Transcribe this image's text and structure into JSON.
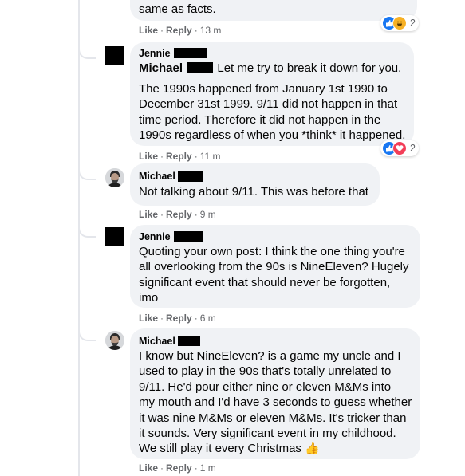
{
  "comments": [
    {
      "author": "",
      "text_lines": [
        "same as facts."
      ],
      "actions": {
        "like": "Like",
        "reply": "Reply",
        "time": "13 m"
      },
      "reactions": {
        "icons": [
          "like-icon",
          "haha-icon"
        ],
        "count": "2"
      }
    },
    {
      "author": "Jennie",
      "mention": "Michael",
      "text_first_line": "Let me try to break it down for you.",
      "text_lines": [
        "The 1990s happened from January 1st 1990 to",
        "December 31st 1999. 9/11 did not happen in that",
        "time period. Therefore it did not happen in the",
        "1990s regardless of when you *think* it happened."
      ],
      "actions": {
        "like": "Like",
        "reply": "Reply",
        "time": "11 m"
      },
      "reactions": {
        "icons": [
          "like-icon",
          "love-icon"
        ],
        "count": "2"
      }
    },
    {
      "author": "Michael",
      "text_lines": [
        "Not talking about 9/11. This was before that"
      ],
      "actions": {
        "like": "Like",
        "reply": "Reply",
        "time": "9 m"
      }
    },
    {
      "author": "Jennie",
      "text_lines": [
        "Quoting your own post: I think the one thing you're",
        "all overlooking from the 90s is NineEleven? Hugely",
        "significant event that should never be forgotten,",
        "imo"
      ],
      "actions": {
        "like": "Like",
        "reply": "Reply",
        "time": "6 m"
      }
    },
    {
      "author": "Michael",
      "text_lines": [
        "I know but NineEleven? is a game my uncle and I",
        "used to play in the 90s that's totally unrelated to",
        "9/11. He'd pour either nine or eleven M&Ms into",
        "my mouth and I'd have 3 seconds to guess whether",
        "it was nine M&Ms or eleven M&Ms. It's tricker than",
        "it sounds. Very significant event in my childhood.",
        "We still play it every Christmas 👍"
      ],
      "actions": {
        "like": "Like",
        "reply": "Reply",
        "time": "1 m"
      }
    }
  ],
  "separator": "·",
  "colors": {
    "bubble": "#f0f2f5",
    "meta": "#65676b",
    "text": "#050505",
    "like_blue": "#1877f2",
    "love_red": "#f33e58",
    "haha_yellow": "#f7b125"
  }
}
